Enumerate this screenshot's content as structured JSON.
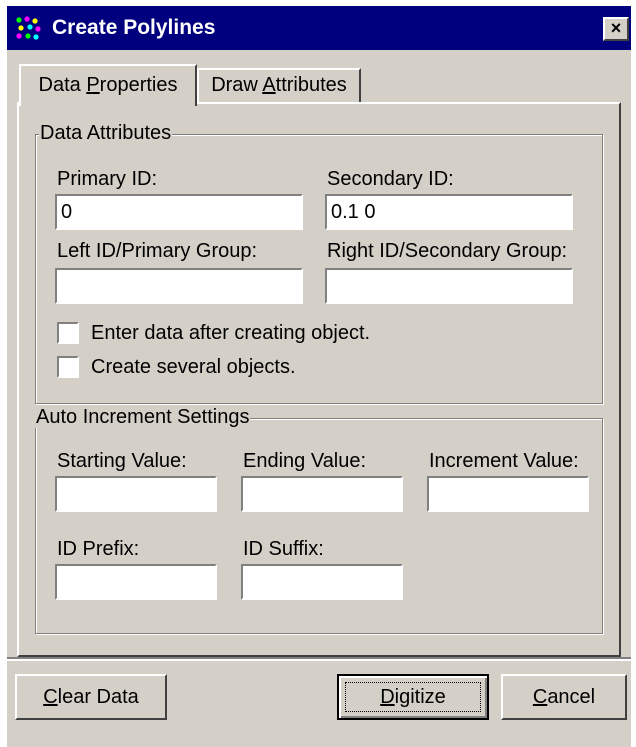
{
  "window": {
    "title": "Create Polylines",
    "app_icon": "polyline-dots-icon",
    "close_icon": "close-icon",
    "close_glyph": "×"
  },
  "tabs": [
    {
      "pre": "Data ",
      "key": "P",
      "post": "roperties",
      "selected": true
    },
    {
      "pre": "Draw ",
      "key": "A",
      "post": "ttributes",
      "selected": false
    }
  ],
  "data_attributes": {
    "legend": "Data Attributes",
    "primary_id": {
      "label": "Primary ID:",
      "value": "0"
    },
    "secondary_id": {
      "label": "Secondary ID:",
      "value": "0.1 0"
    },
    "left_id": {
      "label": "Left ID/Primary Group:",
      "value": ""
    },
    "right_id": {
      "label": "Right ID/Secondary Group:",
      "value": ""
    },
    "enter_data_checkbox": {
      "label": "Enter data after creating object.",
      "checked": false
    },
    "several_objects_checkbox": {
      "label": "Create several objects.",
      "checked": false
    }
  },
  "auto_increment": {
    "legend": "Auto Increment Settings",
    "starting_value": {
      "label": "Starting Value:",
      "value": ""
    },
    "ending_value": {
      "label": "Ending Value:",
      "value": ""
    },
    "increment_value": {
      "label": "Increment Value:",
      "value": ""
    },
    "id_prefix": {
      "label": "ID Prefix:",
      "value": ""
    },
    "id_suffix": {
      "label": "ID Suffix:",
      "value": ""
    }
  },
  "buttons": {
    "clear": {
      "pre": "",
      "key": "C",
      "post": "lear Data"
    },
    "digitize": {
      "pre": "",
      "key": "D",
      "post": "igitize"
    },
    "cancel": {
      "pre": "",
      "key": "C",
      "post": "ancel"
    }
  },
  "colors": {
    "titlebar": "#00007f",
    "face": "#d4d0c8",
    "shadow": "#808080",
    "highlight": "#ffffff"
  }
}
